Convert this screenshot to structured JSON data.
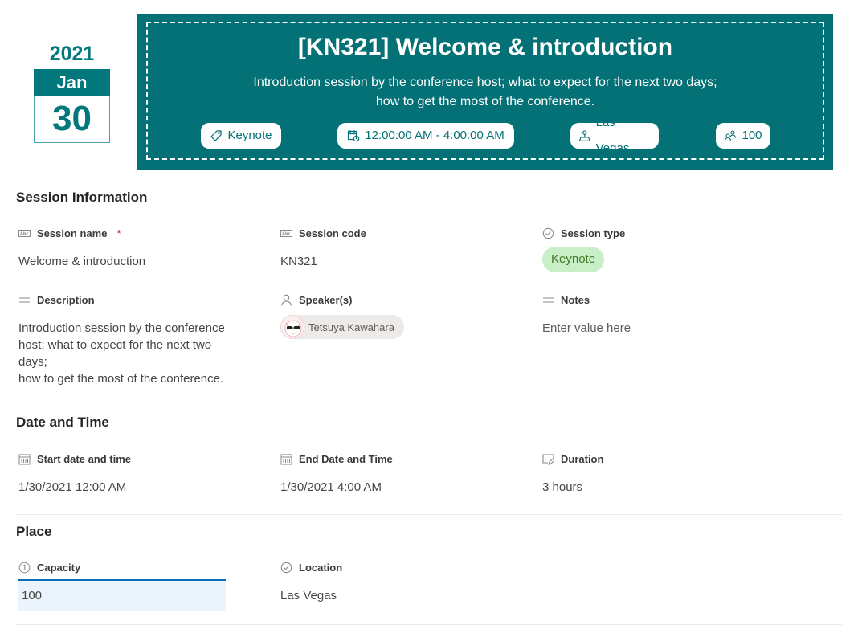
{
  "date_tile": {
    "year": "2021",
    "month": "Jan",
    "day": "30"
  },
  "banner": {
    "title": "[KN321]  Welcome & introduction",
    "description_line1": "Introduction session by the conference host; what to expect for the next two days;",
    "description_line2": "how to get the most of the conference.",
    "pills": {
      "type": {
        "icon": "tag-icon",
        "label": "Keynote"
      },
      "time": {
        "icon": "calendar-clock-icon",
        "label": "12:00:00 AM - 4:00:00 AM"
      },
      "location": {
        "icon": "location-icon",
        "label": "Las Vegas"
      },
      "capacity": {
        "icon": "people-icon",
        "label": "100"
      }
    },
    "colors": {
      "background": "#037176",
      "text": "#ffffff"
    }
  },
  "sections": {
    "session_info": {
      "title": "Session Information",
      "fields": {
        "session_name": {
          "icon": "text-field-icon",
          "label": "Session name",
          "required_mark": "*",
          "value": "Welcome & introduction"
        },
        "session_code": {
          "icon": "text-field-icon",
          "label": "Session code",
          "value": "KN321"
        },
        "session_type": {
          "icon": "choice-check-icon",
          "label": "Session type",
          "value": "Keynote"
        },
        "description": {
          "icon": "multiline-text-icon",
          "label": "Description",
          "value_lines": [
            "Introduction session by the conference",
            "host; what to expect for the next two",
            "days;",
            "how to get the most of the conference."
          ]
        },
        "speakers": {
          "icon": "person-icon",
          "label": "Speaker(s)",
          "value": "Tetsuya Kawahara"
        },
        "notes": {
          "icon": "multiline-text-icon",
          "label": "Notes",
          "placeholder": "Enter value here"
        }
      }
    },
    "date_time": {
      "title": "Date and Time",
      "fields": {
        "start": {
          "icon": "calendar-icon",
          "label": "Start date and time",
          "value": "1/30/2021 12:00 AM"
        },
        "end": {
          "icon": "calendar-icon",
          "label": "End Date and Time",
          "value": "1/30/2021 4:00 AM"
        },
        "duration": {
          "icon": "duration-icon",
          "label": "Duration",
          "value": "3 hours"
        }
      }
    },
    "place": {
      "title": "Place",
      "fields": {
        "capacity": {
          "icon": "number-icon",
          "label": "Capacity",
          "value": "100"
        },
        "location": {
          "icon": "choice-check-icon",
          "label": "Location",
          "value": "Las Vegas"
        }
      }
    }
  },
  "colors": {
    "accent": "#03787c",
    "badge_bg": "#c9efc8",
    "badge_text": "#437a26",
    "focus_border": "#0f6cbd",
    "focus_bg": "#ebf3fc"
  }
}
